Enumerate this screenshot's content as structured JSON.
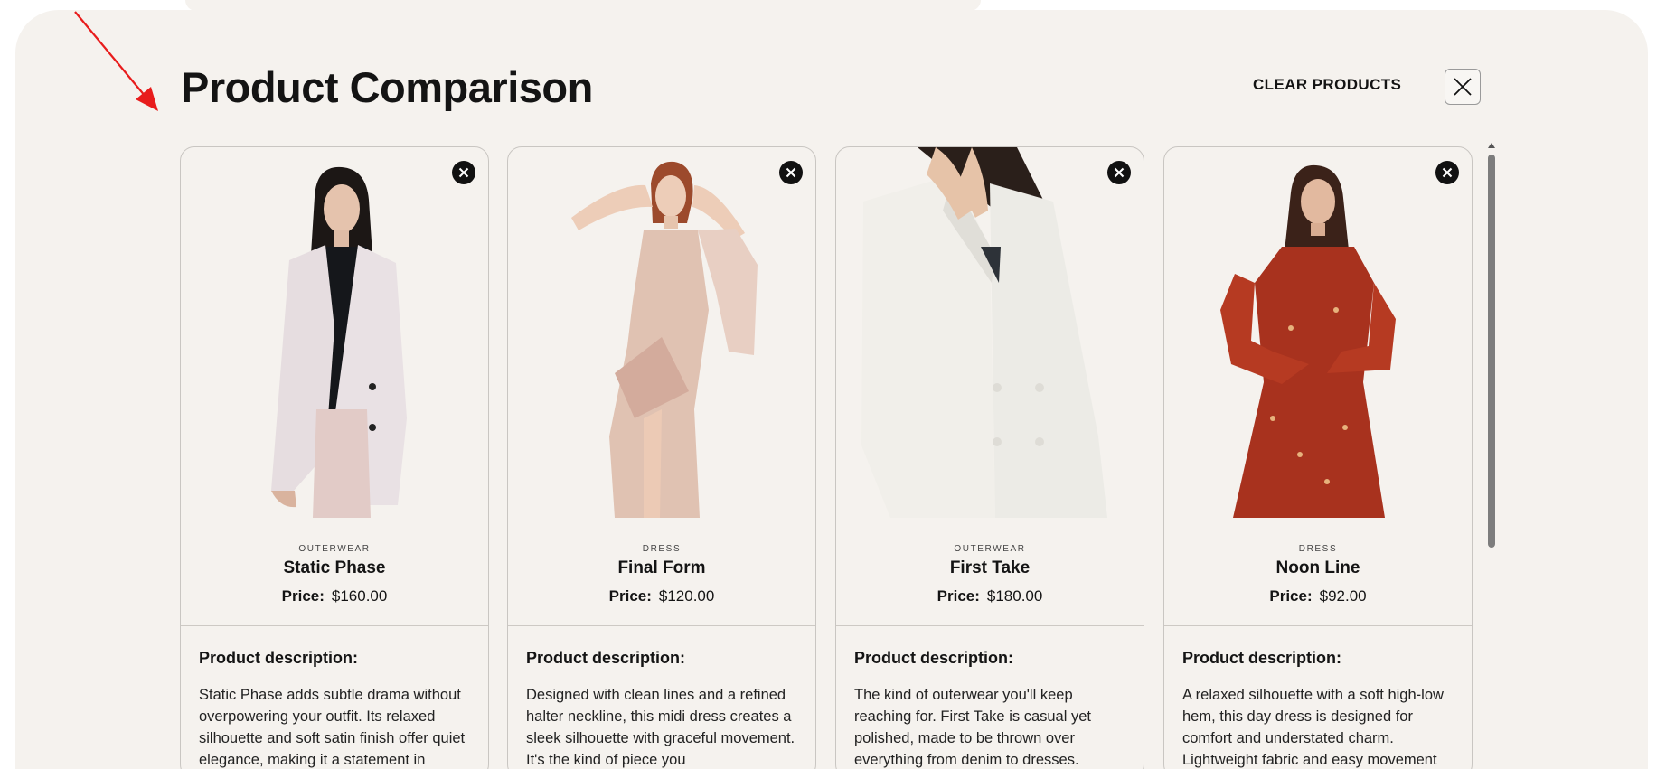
{
  "modal": {
    "title": "Product Comparison",
    "clear_label": "CLEAR PRODUCTS",
    "close_icon": "close-icon"
  },
  "colors": {
    "background": "#f5f2ee",
    "annotation_arrow": "#e81c1c",
    "text": "#141414",
    "remove_button": "#111111"
  },
  "products": [
    {
      "category": "OUTERWEAR",
      "name": "Static Phase",
      "price_label": "Price:",
      "price": "$160.00",
      "description_heading": "Product description:",
      "description": "Static Phase adds subtle drama without overpowering your outfit. Its relaxed silhouette and soft satin finish offer quiet elegance, making it a statement in",
      "image": "woman in lilac blazer and black top"
    },
    {
      "category": "DRESS",
      "name": "Final Form",
      "price_label": "Price:",
      "price": "$120.00",
      "description_heading": "Product description:",
      "description": "Designed with clean lines and a refined halter neckline, this midi dress creates a sleek silhouette with graceful movement. It's the kind of piece you",
      "image": "woman in sequined champagne dress"
    },
    {
      "category": "OUTERWEAR",
      "name": "First Take",
      "price_label": "Price:",
      "price": "$180.00",
      "description_heading": "Product description:",
      "description": "The kind of outerwear you'll keep reaching for. First Take is casual yet polished, made to be thrown over everything from denim to dresses.",
      "image": "white double-breasted blazer close-up"
    },
    {
      "category": "DRESS",
      "name": "Noon Line",
      "price_label": "Price:",
      "price": "$92.00",
      "description_heading": "Product description:",
      "description": "A relaxed silhouette with a soft high-low hem, this day dress is designed for comfort and understated charm. Lightweight fabric and easy movement",
      "image": "woman in red floral dress"
    }
  ]
}
